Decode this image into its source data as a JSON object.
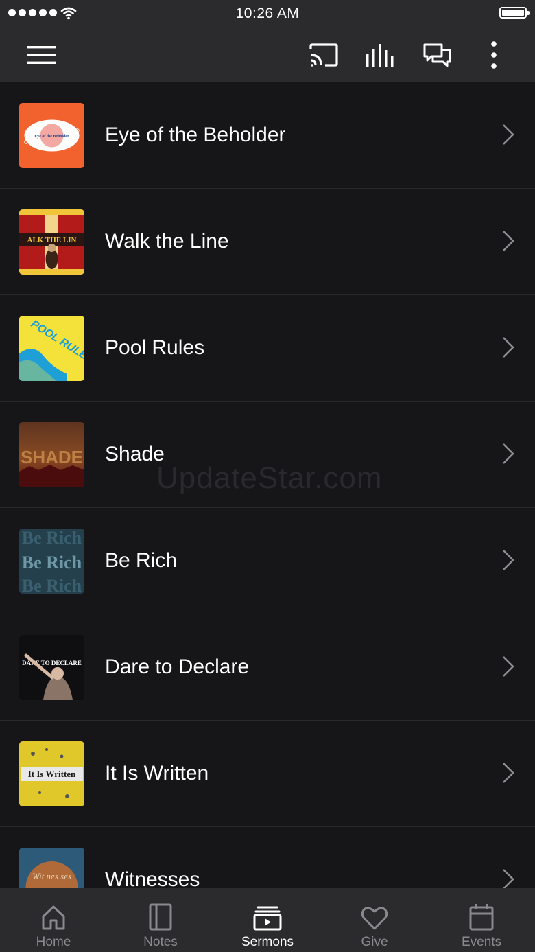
{
  "status_bar": {
    "time": "10:26 AM"
  },
  "app_bar": {
    "icons": [
      "menu-icon",
      "cast-icon",
      "audio-bars-icon",
      "chat-icon",
      "more-vertical-icon"
    ]
  },
  "sermons": [
    {
      "title": "Eye of the Beholder",
      "thumb_text": "Eye of the Beholder",
      "accent": "#f2622e"
    },
    {
      "title": "Walk the Line",
      "thumb_text": "ALK THE LIN",
      "accent": "#b31b1b"
    },
    {
      "title": "Pool Rules",
      "thumb_text": "POOL RULES",
      "accent": "#f4e13a"
    },
    {
      "title": "Shade",
      "thumb_text": "SHADE",
      "accent": "#7a3b1c"
    },
    {
      "title": "Be Rich",
      "thumb_text": "Be Rich",
      "accent": "#2b4a57"
    },
    {
      "title": "Dare to Declare",
      "thumb_text": "DARE TO DECLARE",
      "accent": "#0f0f12"
    },
    {
      "title": "It Is Written",
      "thumb_text": "It Is Written",
      "accent": "#e0c82a"
    },
    {
      "title": "Witnesses",
      "thumb_text": "Wit nes ses",
      "accent": "#2e5a7a"
    }
  ],
  "watermark": "UpdateStar.com",
  "tabs": [
    {
      "label": "Home",
      "icon": "home-icon"
    },
    {
      "label": "Notes",
      "icon": "notes-icon"
    },
    {
      "label": "Sermons",
      "icon": "sermons-icon",
      "active": true
    },
    {
      "label": "Give",
      "icon": "heart-icon"
    },
    {
      "label": "Events",
      "icon": "calendar-icon"
    }
  ]
}
